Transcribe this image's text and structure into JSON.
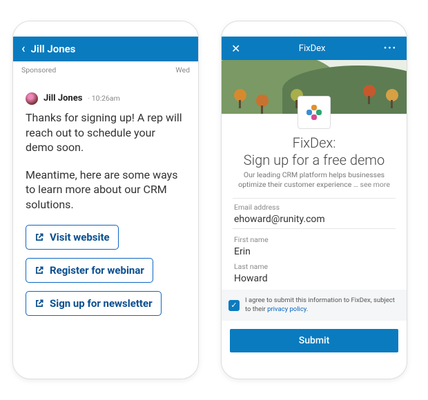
{
  "left": {
    "header_name": "Jill Jones",
    "sponsored": "Sponsored",
    "day": "Wed",
    "author_name": "Jill Jones",
    "author_time": "10:26am",
    "paragraph1": "Thanks for signing up! A rep will reach out to schedule your demo soon.",
    "paragraph2": "Meantime, here are some ways to learn more about our CRM solutions.",
    "cta1": "Visit website",
    "cta2": "Register for webinar",
    "cta3": "Sign up for newsletter"
  },
  "right": {
    "app_title": "FixDex",
    "heading_line": "FixDex:\nSign up for a free demo",
    "subtext": "Our leading CRM platform helps businesses optimize their customer experience",
    "see_more": "… see more",
    "fields": {
      "email_label": "Email address",
      "email_value": "ehoward@runity.com",
      "first_label": "First name",
      "first_value": "Erin",
      "last_label": "Last name",
      "last_value": "Howard"
    },
    "consent_prefix": "I agree to submit this information to FixDex, subject to their ",
    "consent_link": "privacy policy",
    "consent_suffix": ".",
    "submit": "Submit"
  }
}
